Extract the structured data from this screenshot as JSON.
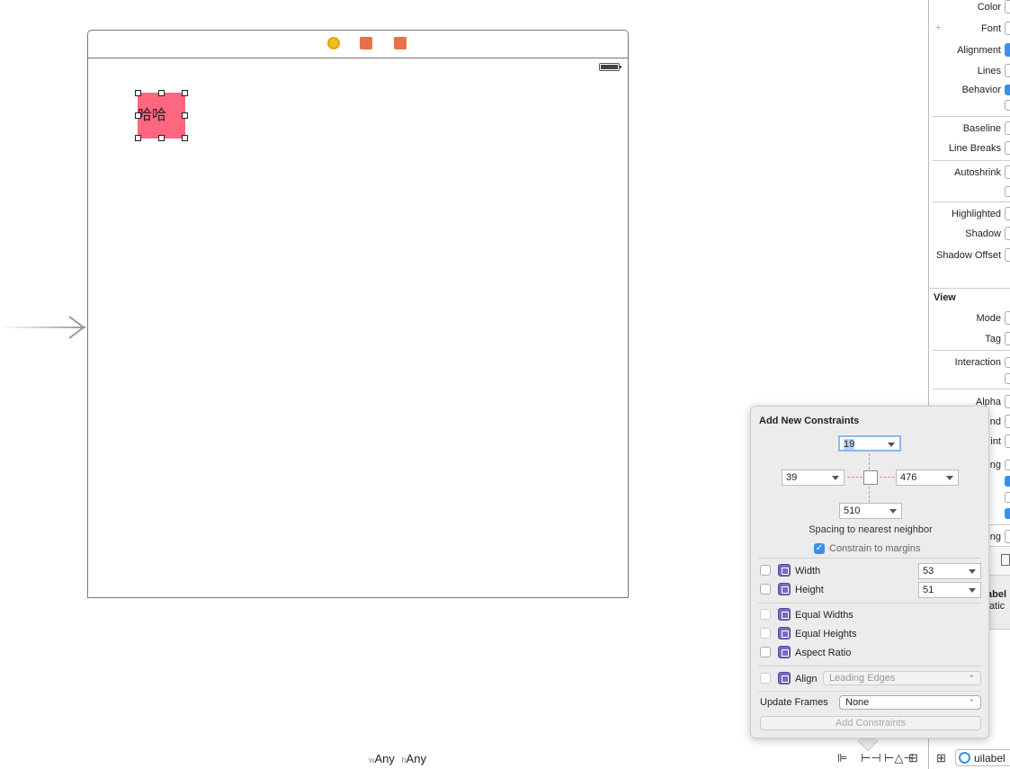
{
  "canvas": {
    "label_text": "哈哈",
    "label_color": "#ff6680",
    "dock_icons": [
      "view-controller-icon",
      "first-responder-icon",
      "exit-icon"
    ]
  },
  "inspector": {
    "rows": [
      "Color",
      "Font",
      "Alignment",
      "Lines",
      "Behavior",
      "Baseline",
      "Line Breaks",
      "Autoshrink",
      "Highlighted",
      "Shadow",
      "Shadow Offset"
    ],
    "font_prefix": "+",
    "view_section": "View",
    "view_rows": [
      "Mode",
      "Tag",
      "Interaction",
      "Alpha",
      "nd",
      "int",
      "ng",
      "ng"
    ],
    "library_title": "abel",
    "library_subtitle": "tatic"
  },
  "popover": {
    "title": "Add New Constraints",
    "top": "19",
    "left": "39",
    "right": "476",
    "bottom": "510",
    "spacing_label": "Spacing to nearest neighbor",
    "constrain_margins": "Constrain to margins",
    "width_label": "Width",
    "width_value": "53",
    "height_label": "Height",
    "height_value": "51",
    "equal_widths": "Equal Widths",
    "equal_heights": "Equal Heights",
    "aspect_ratio": "Aspect Ratio",
    "align_label": "Align",
    "align_value": "Leading Edges",
    "update_frames_label": "Update Frames",
    "update_frames_value": "None",
    "add_button": "Add Constraints"
  },
  "bottom": {
    "size_w_prefix": "w",
    "size_w": "Any",
    "size_h_prefix": "h",
    "size_h": "Any",
    "filter_value": "uilabel"
  }
}
